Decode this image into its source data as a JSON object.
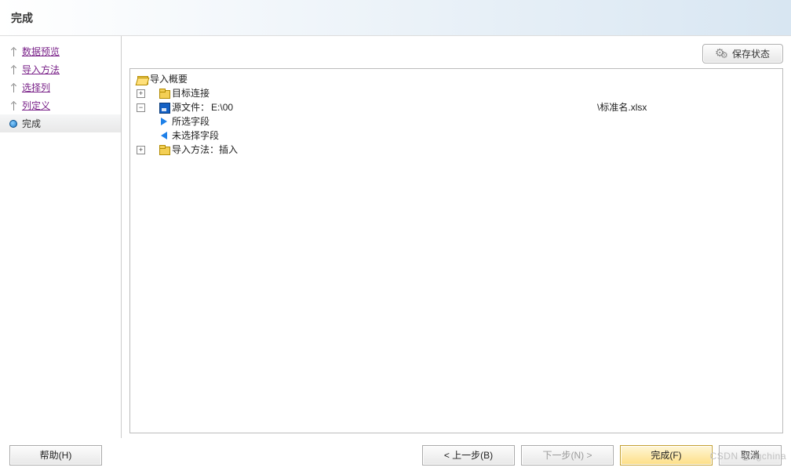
{
  "header": {
    "title": "完成"
  },
  "sidebar": {
    "items": [
      {
        "label": "数据预览"
      },
      {
        "label": "导入方法"
      },
      {
        "label": "选择列"
      },
      {
        "label": "列定义"
      },
      {
        "label": "完成",
        "selected": true
      }
    ]
  },
  "main": {
    "save_state_label": "保存状态",
    "tree": {
      "root_label": "导入概要",
      "target_conn_label": "目标连接",
      "source_file_prefix": "源文件：",
      "source_file_path_start": "E:\\00",
      "source_file_path_end": "\\标准名.xlsx",
      "selected_fields_label": "所选字段",
      "unselected_fields_label": "未选择字段",
      "import_method_label": "导入方法：插入"
    }
  },
  "footer": {
    "help_label": "帮助(H)",
    "prev_label": "< 上一步(B)",
    "next_label": "下一步(N) >",
    "finish_label": "完成(F)",
    "cancel_label": "取消"
  },
  "watermark": "CSDN @xgchina"
}
